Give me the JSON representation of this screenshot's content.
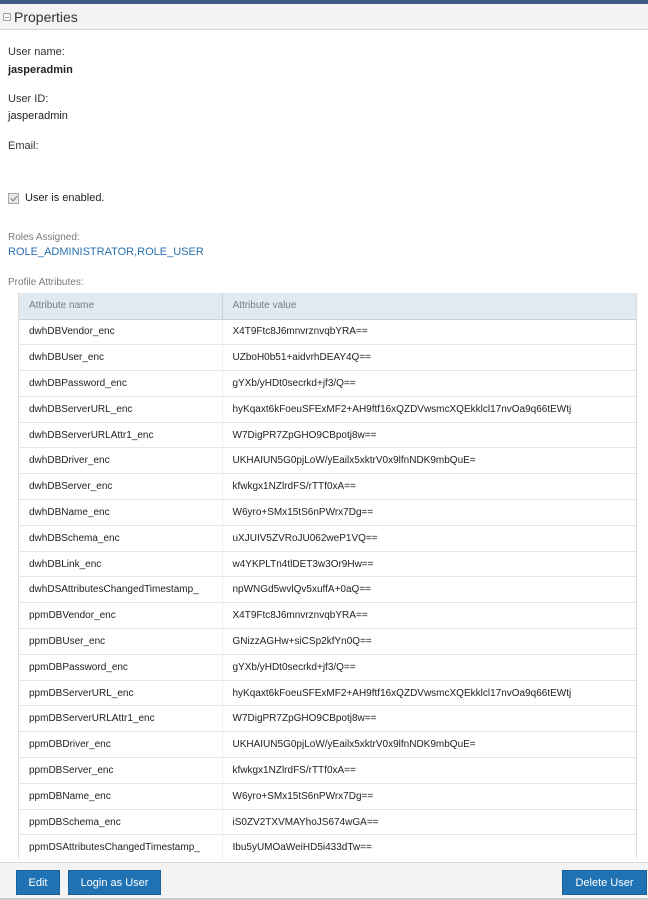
{
  "header": {
    "title": "Properties"
  },
  "user": {
    "name_label": "User name:",
    "name_value": "jasperadmin",
    "id_label": "User ID:",
    "id_value": "jasperadmin",
    "email_label": "Email:",
    "email_value": "",
    "enabled_label": "User is enabled.",
    "enabled": true
  },
  "roles": {
    "label": "Roles Assigned:",
    "value": "ROLE_ADMINISTRATOR,ROLE_USER"
  },
  "profile": {
    "label": "Profile Attributes:",
    "columns": [
      "Attribute name",
      "Attribute value"
    ],
    "rows": [
      [
        "dwhDBVendor_enc",
        "X4T9Ftc8J6mnvrznvqbYRA=="
      ],
      [
        "dwhDBUser_enc",
        "UZboH0b51+aidvrhDEAY4Q=="
      ],
      [
        "dwhDBPassword_enc",
        "gYXb/yHDt0secrkd+jf3/Q=="
      ],
      [
        "dwhDBServerURL_enc",
        "hyKqaxt6kFoeuSFExMF2+AH9ftf16xQZDVwsmcXQEkklcl17nvOa9q66tEWtj"
      ],
      [
        "dwhDBServerURLAttr1_enc",
        "W7DigPR7ZpGHO9CBpotj8w=="
      ],
      [
        "dwhDBDriver_enc",
        "UKHAIUN5G0pjLoW/yEailx5xktrV0x9lfnNDK9mbQuE="
      ],
      [
        "dwhDBServer_enc",
        "kfwkgx1NZlrdFS/rTTf0xA=="
      ],
      [
        "dwhDBName_enc",
        "W6yro+SMx15tS6nPWrx7Dg=="
      ],
      [
        "dwhDBSchema_enc",
        "uXJUIV5ZVRoJU062weP1VQ=="
      ],
      [
        "dwhDBLink_enc",
        "w4YKPLTn4tlDET3w3Or9Hw=="
      ],
      [
        "dwhDSAttributesChangedTimestamp_",
        "npWNGd5wvlQv5xuffA+0aQ=="
      ],
      [
        "ppmDBVendor_enc",
        "X4T9Ftc8J6mnvrznvqbYRA=="
      ],
      [
        "ppmDBUser_enc",
        "GNizzAGHw+siCSp2kfYn0Q=="
      ],
      [
        "ppmDBPassword_enc",
        "gYXb/yHDt0secrkd+jf3/Q=="
      ],
      [
        "ppmDBServerURL_enc",
        "hyKqaxt6kFoeuSFExMF2+AH9ftf16xQZDVwsmcXQEkklcl17nvOa9q66tEWtj"
      ],
      [
        "ppmDBServerURLAttr1_enc",
        "W7DigPR7ZpGHO9CBpotj8w=="
      ],
      [
        "ppmDBDriver_enc",
        "UKHAIUN5G0pjLoW/yEailx5xktrV0x9lfnNDK9mbQuE="
      ],
      [
        "ppmDBServer_enc",
        "kfwkgx1NZlrdFS/rTTf0xA=="
      ],
      [
        "ppmDBName_enc",
        "W6yro+SMx15tS6nPWrx7Dg=="
      ],
      [
        "ppmDBSchema_enc",
        "iS0ZV2TXVMAYhoJS674wGA=="
      ],
      [
        "ppmDSAttributesChangedTimestamp_",
        "Ibu5yUMOaWeiHD5i433dTw=="
      ]
    ]
  },
  "footer": {
    "edit_label": "Edit",
    "login_label": "Login as User",
    "delete_label": "Delete User"
  },
  "colors": {
    "button": "#1f72b3",
    "link": "#2a6fb0",
    "table_header": "#e1e9f1"
  }
}
